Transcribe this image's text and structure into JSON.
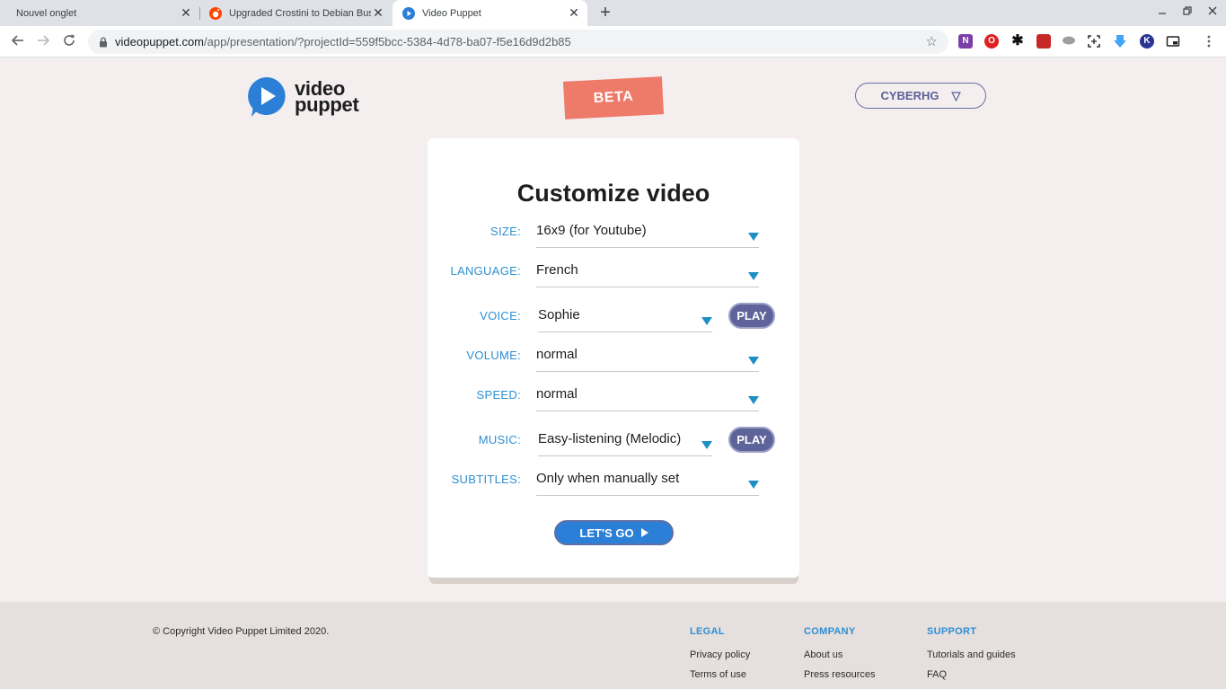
{
  "browser": {
    "tabs": [
      {
        "title": "Nouvel onglet",
        "active": false
      },
      {
        "title": "Upgraded Crostini to Debian Bus",
        "active": false
      },
      {
        "title": "Video Puppet",
        "active": true
      }
    ],
    "url_host": "videopuppet.com",
    "url_path": "/app/presentation/?projectId=559f5bcc-5384-4d78-ba07-f5e16d9d2b85",
    "new_tab_icon": "+",
    "close_icon": "✕"
  },
  "header": {
    "logo_line1": "video",
    "logo_line2": "puppet",
    "beta": "BETA",
    "user": "CYBERHG",
    "user_menu_icon": "▽"
  },
  "form": {
    "title": "Customize video",
    "fields": [
      {
        "label": "SIZE:",
        "value": "16x9 (for Youtube)"
      },
      {
        "label": "LANGUAGE:",
        "value": "French"
      },
      {
        "label": "VOICE:",
        "value": "Sophie"
      },
      {
        "label": "VOLUME:",
        "value": "normal"
      },
      {
        "label": "SPEED:",
        "value": "normal"
      },
      {
        "label": "MUSIC:",
        "value": "Easy-listening (Melodic)"
      },
      {
        "label": "SUBTITLES:",
        "value": "Only when manually set"
      }
    ],
    "play_label": "PLAY",
    "go_label": "LET'S GO"
  },
  "footer": {
    "copyright": "© Copyright Video Puppet Limited 2020.",
    "legal": {
      "heading": "LEGAL",
      "links": [
        "Privacy policy",
        "Terms of use"
      ]
    },
    "company": {
      "heading": "COMPANY",
      "links": [
        "About us",
        "Press resources"
      ]
    },
    "support": {
      "heading": "SUPPORT",
      "links": [
        "Tutorials and guides",
        "FAQ"
      ]
    }
  },
  "colors": {
    "accent_blue": "#2d8fd3",
    "play_purple": "#5e6499",
    "beta_red": "#ee7a6a",
    "page_bg": "#f4efee"
  }
}
